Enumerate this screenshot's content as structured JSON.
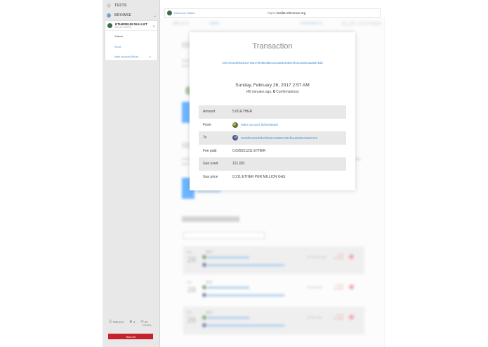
{
  "sidebar": {
    "tests_label": "TESTS",
    "browse_label": "BROWSE",
    "wallet": {
      "title": "ETHEREUM WALLET",
      "subtitle": "ECLAT 16 ETH",
      "items": [
        "Wallets",
        "Send",
        "Main account (Ether..."
      ],
      "badge": "M..."
    },
    "stats": {
      "peers": "106,211",
      "blocks": "4",
      "time": "41",
      "time_unit": "minutes"
    },
    "testnet_label": "Test-net"
  },
  "browser": {
    "tab_label": "Ethereum Wallet",
    "url_prefix": "https://",
    "url_host": "wallet.ethereum.org"
  },
  "background_page": {
    "nav": [
      "WALLETS",
      "SEND",
      "CONTRACTS",
      "20,147.19 ETHER"
    ],
    "rows": [
      {
        "label": "Feb",
        "day": "26",
        "title": "Sent",
        "ago": "40 minutes ago",
        "amount": "-5.00 ETHER"
      },
      {
        "label": "Feb",
        "day": "26",
        "title": "Sent",
        "ago": "an hour ago",
        "amount": "-10.00 ETHER"
      },
      {
        "label": "Feb",
        "day": "26",
        "title": "Sent",
        "ago": "an hour ago",
        "amount": "-10.00 ETHER"
      }
    ]
  },
  "modal": {
    "title": "Transaction",
    "hash": "0xfc7d7a31f9dc9447195179f08b08b21c52a8de40b0e9f33c1b09a4ad8d7bdd",
    "date": "Sunday, February 26, 2017 2:57 AM",
    "confirmations_prefix": "(40 minutes ago,",
    "confirmations_count": "0",
    "confirmations_suffix": "Confirmations)",
    "fields": {
      "amount_label": "Amount",
      "amount_value": "5.00 ETHER",
      "from_label": "From",
      "from_value": "Main account (EtherBase)",
      "to_label": "To",
      "to_value": "0x06f5c531d5fa1f6841026867394f5a4286E40a6AC3",
      "fee_label": "Fee paid",
      "fee_value": "0.025531211 ETHER",
      "gas_used_label": "Gas used",
      "gas_used_value": "121,001",
      "gas_price_label": "Gas price",
      "gas_price_value": "0.211 ETHER PER MILLION GAS"
    }
  },
  "colors": {
    "accent": "#4a8fd6",
    "testnet": "#c7212a",
    "row_shade": "#e8e8e8"
  }
}
